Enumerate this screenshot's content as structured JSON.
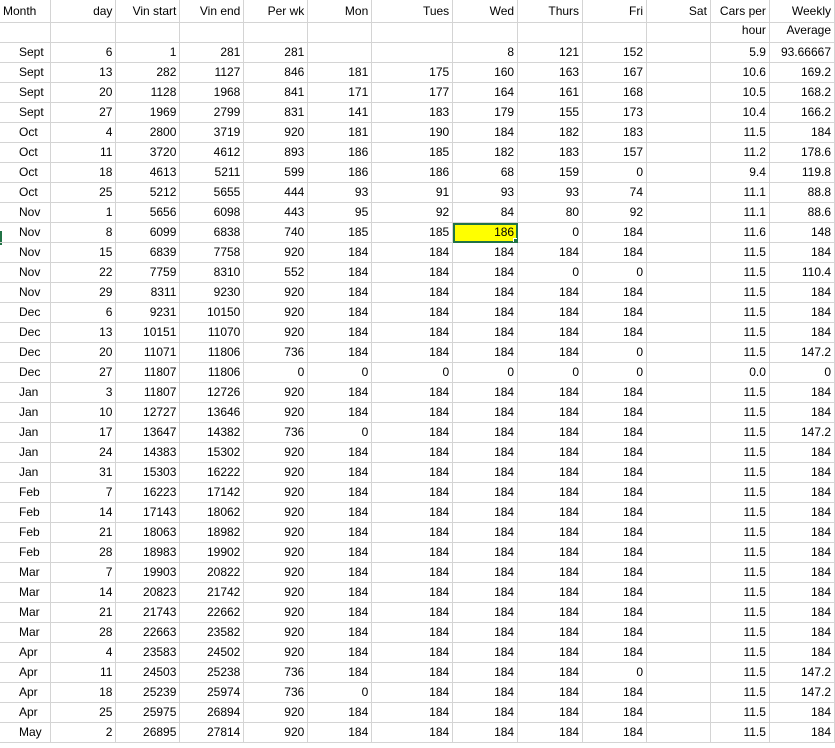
{
  "headers": {
    "row1": [
      "Month",
      "day",
      "Vin start",
      "Vin end",
      "Per wk",
      "Mon",
      "Tues",
      "Wed",
      "Thurs",
      "Fri",
      "Sat",
      "Cars per",
      "Weekly"
    ],
    "row2": [
      "",
      "",
      "",
      "",
      "",
      "",
      "",
      "",
      "",
      "",
      "",
      "hour",
      "Average"
    ]
  },
  "selected_cell": {
    "row": 9,
    "col": 7,
    "fill": "#ffff00",
    "border": "#217346"
  },
  "rows": [
    [
      "Sept",
      "6",
      "1",
      "281",
      "281",
      "",
      "",
      "8",
      "121",
      "152",
      "",
      "5.9",
      "93.66667"
    ],
    [
      "Sept",
      "13",
      "282",
      "1127",
      "846",
      "181",
      "175",
      "160",
      "163",
      "167",
      "",
      "10.6",
      "169.2"
    ],
    [
      "Sept",
      "20",
      "1128",
      "1968",
      "841",
      "171",
      "177",
      "164",
      "161",
      "168",
      "",
      "10.5",
      "168.2"
    ],
    [
      "Sept",
      "27",
      "1969",
      "2799",
      "831",
      "141",
      "183",
      "179",
      "155",
      "173",
      "",
      "10.4",
      "166.2"
    ],
    [
      "Oct",
      "4",
      "2800",
      "3719",
      "920",
      "181",
      "190",
      "184",
      "182",
      "183",
      "",
      "11.5",
      "184"
    ],
    [
      "Oct",
      "11",
      "3720",
      "4612",
      "893",
      "186",
      "185",
      "182",
      "183",
      "157",
      "",
      "11.2",
      "178.6"
    ],
    [
      "Oct",
      "18",
      "4613",
      "5211",
      "599",
      "186",
      "186",
      "68",
      "159",
      "0",
      "",
      "9.4",
      "119.8"
    ],
    [
      "Oct",
      "25",
      "5212",
      "5655",
      "444",
      "93",
      "91",
      "93",
      "93",
      "74",
      "",
      "11.1",
      "88.8"
    ],
    [
      "Nov",
      "1",
      "5656",
      "6098",
      "443",
      "95",
      "92",
      "84",
      "80",
      "92",
      "",
      "11.1",
      "88.6"
    ],
    [
      "Nov",
      "8",
      "6099",
      "6838",
      "740",
      "185",
      "185",
      "186",
      "0",
      "184",
      "",
      "11.6",
      "148"
    ],
    [
      "Nov",
      "15",
      "6839",
      "7758",
      "920",
      "184",
      "184",
      "184",
      "184",
      "184",
      "",
      "11.5",
      "184"
    ],
    [
      "Nov",
      "22",
      "7759",
      "8310",
      "552",
      "184",
      "184",
      "184",
      "0",
      "0",
      "",
      "11.5",
      "110.4"
    ],
    [
      "Nov",
      "29",
      "8311",
      "9230",
      "920",
      "184",
      "184",
      "184",
      "184",
      "184",
      "",
      "11.5",
      "184"
    ],
    [
      "Dec",
      "6",
      "9231",
      "10150",
      "920",
      "184",
      "184",
      "184",
      "184",
      "184",
      "",
      "11.5",
      "184"
    ],
    [
      "Dec",
      "13",
      "10151",
      "11070",
      "920",
      "184",
      "184",
      "184",
      "184",
      "184",
      "",
      "11.5",
      "184"
    ],
    [
      "Dec",
      "20",
      "11071",
      "11806",
      "736",
      "184",
      "184",
      "184",
      "184",
      "0",
      "",
      "11.5",
      "147.2"
    ],
    [
      "Dec",
      "27",
      "11807",
      "11806",
      "0",
      "0",
      "0",
      "0",
      "0",
      "0",
      "",
      "0.0",
      "0"
    ],
    [
      "Jan",
      "3",
      "11807",
      "12726",
      "920",
      "184",
      "184",
      "184",
      "184",
      "184",
      "",
      "11.5",
      "184"
    ],
    [
      "Jan",
      "10",
      "12727",
      "13646",
      "920",
      "184",
      "184",
      "184",
      "184",
      "184",
      "",
      "11.5",
      "184"
    ],
    [
      "Jan",
      "17",
      "13647",
      "14382",
      "736",
      "0",
      "184",
      "184",
      "184",
      "184",
      "",
      "11.5",
      "147.2"
    ],
    [
      "Jan",
      "24",
      "14383",
      "15302",
      "920",
      "184",
      "184",
      "184",
      "184",
      "184",
      "",
      "11.5",
      "184"
    ],
    [
      "Jan",
      "31",
      "15303",
      "16222",
      "920",
      "184",
      "184",
      "184",
      "184",
      "184",
      "",
      "11.5",
      "184"
    ],
    [
      "Feb",
      "7",
      "16223",
      "17142",
      "920",
      "184",
      "184",
      "184",
      "184",
      "184",
      "",
      "11.5",
      "184"
    ],
    [
      "Feb",
      "14",
      "17143",
      "18062",
      "920",
      "184",
      "184",
      "184",
      "184",
      "184",
      "",
      "11.5",
      "184"
    ],
    [
      "Feb",
      "21",
      "18063",
      "18982",
      "920",
      "184",
      "184",
      "184",
      "184",
      "184",
      "",
      "11.5",
      "184"
    ],
    [
      "Feb",
      "28",
      "18983",
      "19902",
      "920",
      "184",
      "184",
      "184",
      "184",
      "184",
      "",
      "11.5",
      "184"
    ],
    [
      "Mar",
      "7",
      "19903",
      "20822",
      "920",
      "184",
      "184",
      "184",
      "184",
      "184",
      "",
      "11.5",
      "184"
    ],
    [
      "Mar",
      "14",
      "20823",
      "21742",
      "920",
      "184",
      "184",
      "184",
      "184",
      "184",
      "",
      "11.5",
      "184"
    ],
    [
      "Mar",
      "21",
      "21743",
      "22662",
      "920",
      "184",
      "184",
      "184",
      "184",
      "184",
      "",
      "11.5",
      "184"
    ],
    [
      "Mar",
      "28",
      "22663",
      "23582",
      "920",
      "184",
      "184",
      "184",
      "184",
      "184",
      "",
      "11.5",
      "184"
    ],
    [
      "Apr",
      "4",
      "23583",
      "24502",
      "920",
      "184",
      "184",
      "184",
      "184",
      "184",
      "",
      "11.5",
      "184"
    ],
    [
      "Apr",
      "11",
      "24503",
      "25238",
      "736",
      "184",
      "184",
      "184",
      "184",
      "0",
      "",
      "11.5",
      "147.2"
    ],
    [
      "Apr",
      "18",
      "25239",
      "25974",
      "736",
      "0",
      "184",
      "184",
      "184",
      "184",
      "",
      "11.5",
      "147.2"
    ],
    [
      "Apr",
      "25",
      "25975",
      "26894",
      "920",
      "184",
      "184",
      "184",
      "184",
      "184",
      "",
      "11.5",
      "184"
    ],
    [
      "May",
      "2",
      "26895",
      "27814",
      "920",
      "184",
      "184",
      "184",
      "184",
      "184",
      "",
      "11.5",
      "184"
    ]
  ]
}
